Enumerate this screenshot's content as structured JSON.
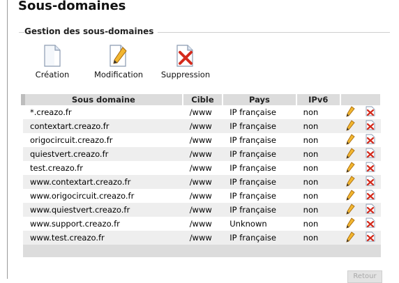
{
  "page": {
    "title": "Sous-domaines"
  },
  "section": {
    "title": "Gestion des sous-domaines"
  },
  "actions": [
    {
      "label": "Création",
      "icon": "document-icon"
    },
    {
      "label": "Modification",
      "icon": "edit-document-icon"
    },
    {
      "label": "Suppression",
      "icon": "delete-document-icon"
    }
  ],
  "table": {
    "headers": [
      "Sous domaine",
      "Cible",
      "Pays",
      "IPv6",
      ""
    ],
    "rows": [
      {
        "domain": "*.creazo.fr",
        "target": "/www",
        "country": "IP française",
        "ipv6": "non"
      },
      {
        "domain": "contextart.creazo.fr",
        "target": "/www",
        "country": "IP française",
        "ipv6": "non"
      },
      {
        "domain": "origocircuit.creazo.fr",
        "target": "/www",
        "country": "IP française",
        "ipv6": "non"
      },
      {
        "domain": "quiestvert.creazo.fr",
        "target": "/www",
        "country": "IP française",
        "ipv6": "non"
      },
      {
        "domain": "test.creazo.fr",
        "target": "/www",
        "country": "IP française",
        "ipv6": "non"
      },
      {
        "domain": "www.contextart.creazo.fr",
        "target": "/www",
        "country": "IP française",
        "ipv6": "non"
      },
      {
        "domain": "www.origocircuit.creazo.fr",
        "target": "/www",
        "country": "IP française",
        "ipv6": "non"
      },
      {
        "domain": "www.quiestvert.creazo.fr",
        "target": "/www",
        "country": "IP française",
        "ipv6": "non"
      },
      {
        "domain": "www.support.creazo.fr",
        "target": "/www",
        "country": "Unknown",
        "ipv6": "non"
      },
      {
        "domain": "www.test.creazo.fr",
        "target": "/www",
        "country": "IP française",
        "ipv6": "non"
      }
    ],
    "row_icons": {
      "edit": "pencil-icon",
      "delete": "delete-icon"
    }
  },
  "footer": {
    "back_label": "Retour"
  },
  "colors": {
    "header_bg": "#dcdcdc",
    "row_alt_bg": "#eeeeee",
    "delete_red": "#d42a1c"
  }
}
